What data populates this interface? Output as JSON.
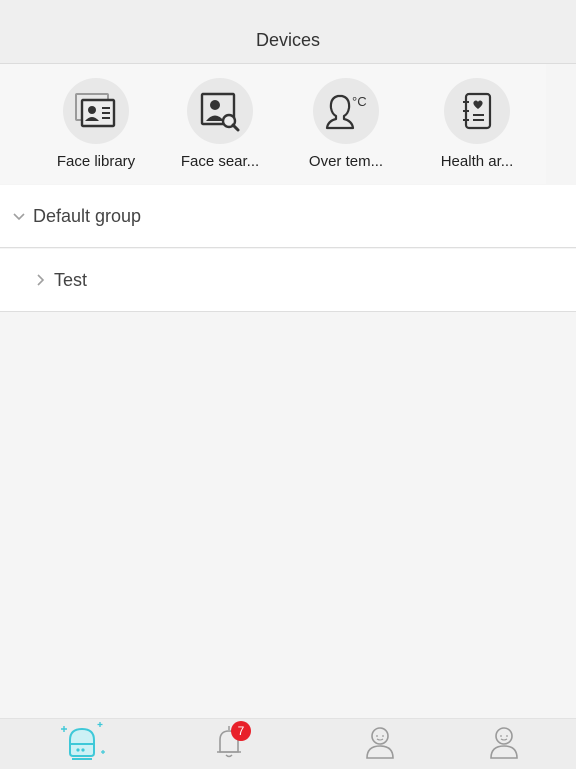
{
  "header": {
    "title": "Devices"
  },
  "quick_actions": [
    {
      "label": "Face library",
      "icon": "face-library-icon"
    },
    {
      "label": "Face sear...",
      "icon": "face-search-icon"
    },
    {
      "label": "Over tem...",
      "icon": "over-temperature-icon"
    },
    {
      "label": "Health ar...",
      "icon": "health-archive-icon"
    }
  ],
  "groups": [
    {
      "label": "Default group",
      "icon": "chevron-down-icon",
      "expanded": true
    },
    {
      "label": "Test",
      "icon": "chevron-right-icon",
      "expanded": false
    }
  ],
  "tabbar": {
    "tabs": [
      {
        "icon": "device-icon",
        "active": true
      },
      {
        "icon": "bell-icon",
        "badge": "7"
      },
      {
        "icon": "person-icon"
      },
      {
        "icon": "profile-icon"
      }
    ],
    "accent_color": "#3ec8d8",
    "inactive_color": "#9a9a9a",
    "badge_color": "#e8202a"
  },
  "colors": {
    "header_bg": "#efefef",
    "background": "#f5f5f5",
    "icon_stroke": "#3a3a3a"
  },
  "temperature_unit": "°C"
}
